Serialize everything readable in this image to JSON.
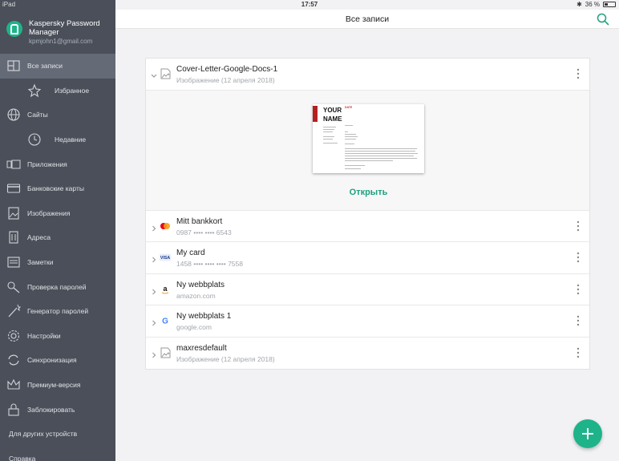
{
  "status_bar": {
    "device": "iPad",
    "time": "17:57",
    "battery": "36 %"
  },
  "brand": {
    "app_name": "Kaspersky Password Manager",
    "email": "kpmjohn1@gmail.com"
  },
  "header": {
    "title": "Все записи"
  },
  "sidebar": {
    "items": [
      {
        "label": "Все записи",
        "icon": "all-records-icon",
        "active": true
      },
      {
        "label": "Избранное",
        "icon": "star-icon",
        "sub": true
      },
      {
        "label": "Сайты",
        "icon": "globe-icon"
      },
      {
        "label": "Недавние",
        "icon": "clock-icon",
        "sub": true
      },
      {
        "label": "Приложения",
        "icon": "apps-icon"
      },
      {
        "label": "Банковские карты",
        "icon": "bank-card-icon"
      },
      {
        "label": "Изображения",
        "icon": "image-icon"
      },
      {
        "label": "Адреса",
        "icon": "building-icon"
      },
      {
        "label": "Заметки",
        "icon": "notes-icon"
      },
      {
        "label": "Проверка паролей",
        "icon": "key-icon"
      },
      {
        "label": "Генератор паролей",
        "icon": "magic-wand-icon"
      },
      {
        "label": "Настройки",
        "icon": "gear-icon"
      },
      {
        "label": "Синхронизация",
        "icon": "sync-icon"
      },
      {
        "label": "Премиум-версия",
        "icon": "crown-icon"
      },
      {
        "label": "Заблокировать",
        "icon": "lock-icon"
      },
      {
        "label": "Для других устройств",
        "icon": ""
      },
      {
        "label": "Справка",
        "icon": ""
      }
    ]
  },
  "records": [
    {
      "name": "Cover-Letter-Google-Docs-1",
      "sub": "Изображение (12 апреля 2018)",
      "icon": "image-file-icon",
      "expanded": true
    },
    {
      "name": "Mitt bankkort",
      "sub": "0987 •••• •••• 6543",
      "icon": "mastercard-icon"
    },
    {
      "name": "My card",
      "sub": "1458 •••• •••• •••• 7558",
      "icon": "visa-icon"
    },
    {
      "name": "Ny webbplats",
      "sub": "amazon.com",
      "icon": "amazon-icon"
    },
    {
      "name": "Ny webbplats 1",
      "sub": "google.com",
      "icon": "google-icon"
    },
    {
      "name": "maxresdefault",
      "sub": "Изображение (12 апреля 2018)",
      "icon": "image-file-icon"
    }
  ],
  "preview": {
    "open_label": "Открыть",
    "doc_heading_1": "YOUR",
    "doc_heading_2": "NAME",
    "doc_date": "DATE"
  },
  "colors": {
    "accent": "#1fb38a",
    "sidebar": "#4a4f59",
    "sidebar_active": "#646a76"
  }
}
